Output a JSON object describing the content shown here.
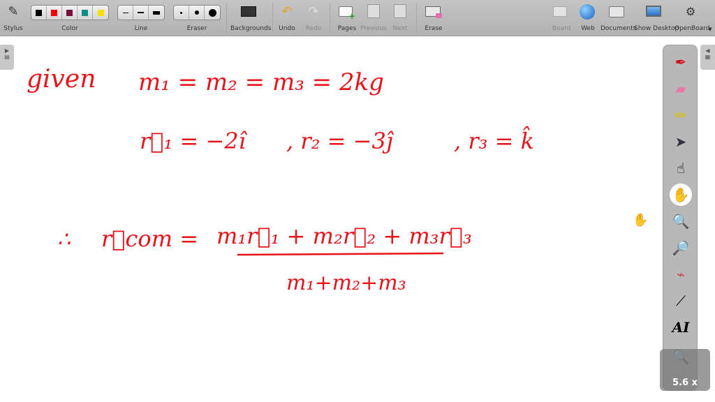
{
  "toolbar": {
    "stylus": "Stylus",
    "color": "Color",
    "line": "Line",
    "eraser": "Eraser",
    "backgrounds": "Backgrounds",
    "undo": "Undo",
    "redo": "Redo",
    "pages": "Pages",
    "previous": "Previous",
    "next": "Next",
    "erase": "Erase",
    "board": "Board",
    "web": "Web",
    "documents": "Documents",
    "show_desktop": "Show Desktop",
    "openboard": "OpenBoard",
    "colors": [
      "#000000",
      "#ff0000",
      "#7a0f3c",
      "#0f8c8c",
      "#f5e000"
    ]
  },
  "zoom_level": "5.6 x",
  "board": {
    "ink_color": "#e8141c",
    "line1_label": "given",
    "line1_eq": "m₁ = m₂ = m₃ = 2kg",
    "line2_r1": "r⃗₁ = −2î",
    "line2_r2": ", r₂ = −3ĵ",
    "line2_r3": ", r₃ = k̂",
    "therefore": "∴",
    "rcom": "r⃗com =",
    "numerator": "m₁r⃗₁ + m₂r⃗₂ + m₃r⃗₃",
    "denominator": "m₁+m₂+m₃"
  }
}
